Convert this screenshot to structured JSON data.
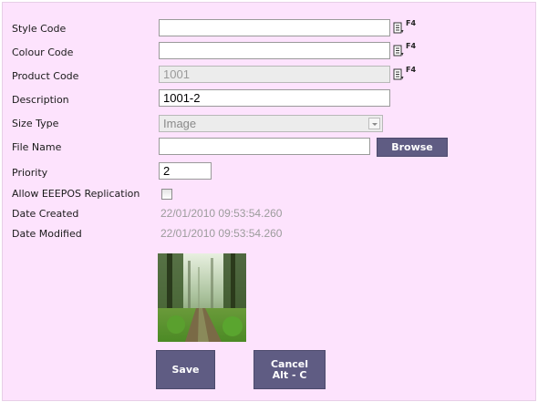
{
  "form": {
    "style_code": {
      "label": "Style Code",
      "value": "",
      "lookup": "F4"
    },
    "colour_code": {
      "label": "Colour Code",
      "value": "",
      "lookup": "F4"
    },
    "product_code": {
      "label": "Product Code",
      "value": "1001",
      "lookup": "F4"
    },
    "description": {
      "label": "Description",
      "value": "1001-2"
    },
    "size_type": {
      "label": "Size Type",
      "value": "Image"
    },
    "file_name": {
      "label": "File Name",
      "value": "",
      "browse_label": "Browse"
    },
    "priority": {
      "label": "Priority",
      "value": "2"
    },
    "allow_replication": {
      "label": "Allow EEEPOS Replication",
      "checked": false
    },
    "date_created": {
      "label": "Date Created",
      "value": "22/01/2010 09:53:54.260"
    },
    "date_modified": {
      "label": "Date Modified",
      "value": "22/01/2010 09:53:54.260"
    }
  },
  "actions": {
    "save_label": "Save",
    "cancel_line1": "Cancel",
    "cancel_line2": "Alt - C"
  },
  "colors": {
    "panel_bg": "#fde3fd",
    "button_bg": "#5f5c83"
  }
}
